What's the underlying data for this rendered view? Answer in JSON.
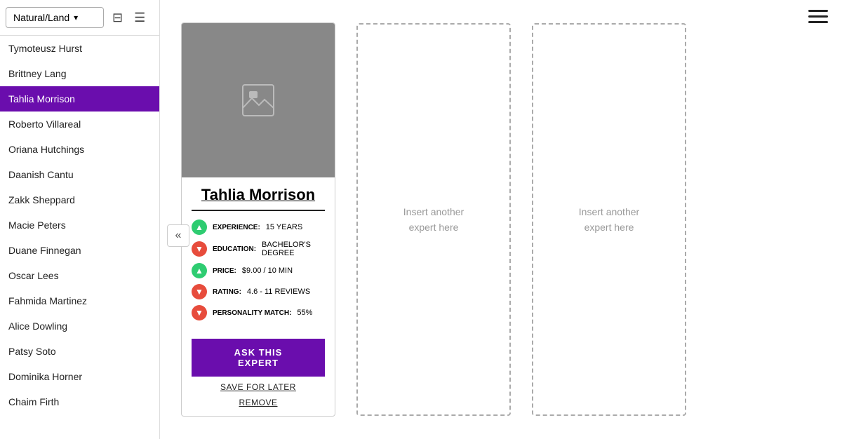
{
  "header": {
    "menu_icon": "☰"
  },
  "sidebar": {
    "filter_label": "Natural/Land",
    "filter_icon": "≡",
    "sort_icon": "⇅",
    "experts": [
      {
        "name": "Tymoteusz Hurst",
        "selected": false
      },
      {
        "name": "Brittney Lang",
        "selected": false
      },
      {
        "name": "Tahlia Morrison",
        "selected": true
      },
      {
        "name": "Roberto Villareal",
        "selected": false
      },
      {
        "name": "Oriana Hutchings",
        "selected": false
      },
      {
        "name": "Daanish Cantu",
        "selected": false
      },
      {
        "name": "Zakk Sheppard",
        "selected": false
      },
      {
        "name": "Macie Peters",
        "selected": false
      },
      {
        "name": "Duane Finnegan",
        "selected": false
      },
      {
        "name": "Oscar Lees",
        "selected": false
      },
      {
        "name": "Fahmida Martinez",
        "selected": false
      },
      {
        "name": "Alice Dowling",
        "selected": false
      },
      {
        "name": "Patsy Soto",
        "selected": false
      },
      {
        "name": "Dominika Horner",
        "selected": false
      },
      {
        "name": "Chaim Firth",
        "selected": false
      }
    ],
    "collapse_icon": "«"
  },
  "expert_card": {
    "name": "Tahlia Morrison",
    "stats": [
      {
        "direction": "up",
        "label": "EXPERIENCE:",
        "value": "15 YEARS"
      },
      {
        "direction": "down",
        "label": "EDUCATION:",
        "value": "BACHELOR'S DEGREE"
      },
      {
        "direction": "up",
        "label": "PRICE:",
        "value": "$9.00 / 10 MIN"
      },
      {
        "direction": "down",
        "label": "RATING:",
        "value": "4.6 - 11 REVIEWS"
      },
      {
        "direction": "down",
        "label": "PERSONALITY MATCH:",
        "value": "55%"
      }
    ],
    "ask_btn_label": "ASK THIS EXPERT",
    "save_label": "SAVE FOR LATER",
    "remove_label": "REMOVE"
  },
  "placeholders": [
    {
      "text": "Insert another\nexpert here"
    },
    {
      "text": "Insert another\nexpert here"
    }
  ]
}
